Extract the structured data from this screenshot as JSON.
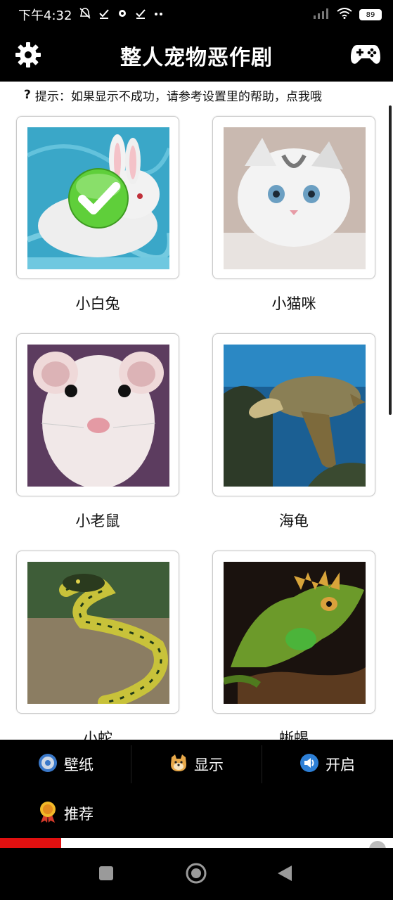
{
  "status": {
    "time": "下午4:32",
    "battery": "89"
  },
  "app": {
    "title": "整人宠物恶作剧",
    "hint_icon": "?",
    "hint_text": "提示：如果显示不成功，请参考设置里的帮助，点我哦"
  },
  "pets": [
    {
      "label": "小白兔",
      "image": "white-rabbit",
      "selected": true
    },
    {
      "label": "小猫咪",
      "image": "kitten",
      "selected": false
    },
    {
      "label": "小老鼠",
      "image": "white-mouse",
      "selected": false
    },
    {
      "label": "海龟",
      "image": "sea-turtle",
      "selected": false
    },
    {
      "label": "小蛇",
      "image": "green-snake",
      "selected": false
    },
    {
      "label": "蜥蜴",
      "image": "iguana",
      "selected": false
    }
  ],
  "bottom_tabs": [
    {
      "label": "壁纸",
      "icon": "gear-icon"
    },
    {
      "label": "显示",
      "icon": "doge-icon"
    },
    {
      "label": "开启",
      "icon": "speaker-icon"
    },
    {
      "label": "推荐",
      "icon": "medal-icon"
    }
  ],
  "colors": {
    "bar_background": "#000000",
    "check_green": "#5fcf3a",
    "ad_red": "#e01010"
  }
}
